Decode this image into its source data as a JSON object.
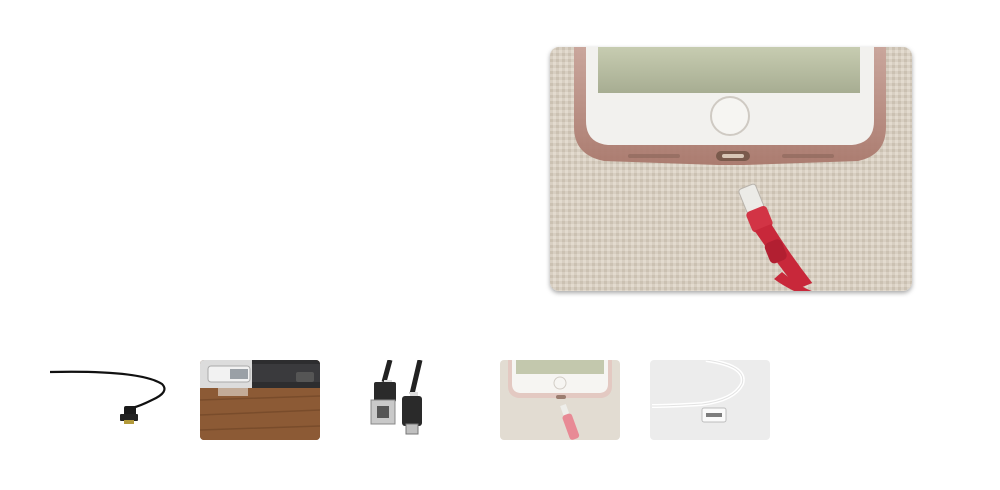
{
  "gallery": {
    "main_image": {
      "icon": "phone-charging-lightning-photo",
      "alt": ""
    },
    "thumbnails": [
      {
        "icon": "black-usb-cable-photo"
      },
      {
        "icon": "usb-plug-laptop-photo"
      },
      {
        "icon": "usb-to-micro-usb-cable-photo"
      },
      {
        "icon": "phone-charging-lightning-photo"
      },
      {
        "icon": "white-apple-cable-photo"
      }
    ]
  },
  "colors": {
    "background": "#ffffff",
    "cable_red": "#c8283a",
    "fabric": "#d9d1c5"
  }
}
